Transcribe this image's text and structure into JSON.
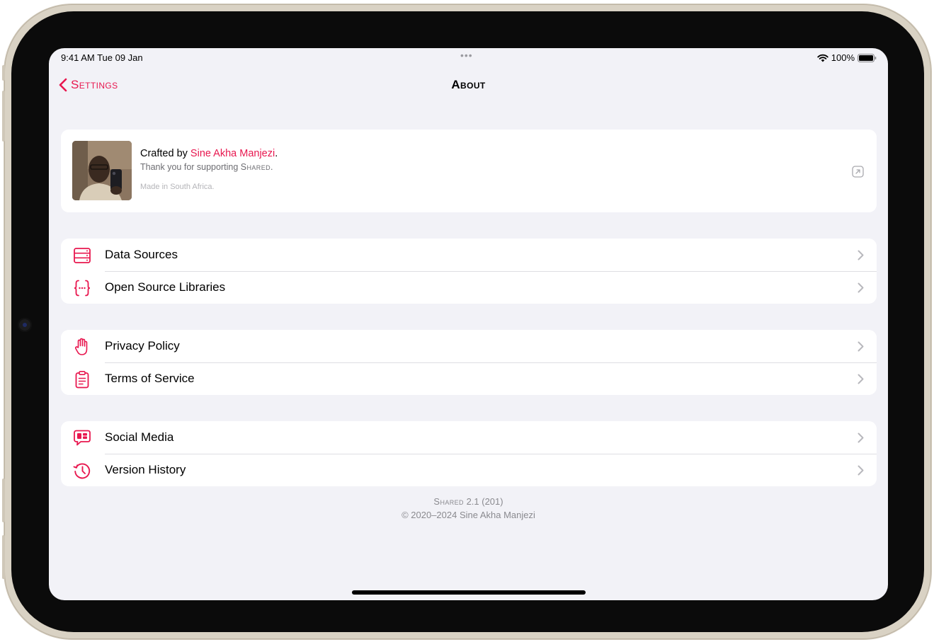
{
  "status_bar": {
    "time": "9:41 AM  Tue 09 Jan",
    "dots": "•••",
    "battery": "100%"
  },
  "nav": {
    "back_label": "Settings",
    "title": "About"
  },
  "profile": {
    "crafted_prefix": "Crafted by ",
    "author": "Sine Akha Manjezi",
    "crafted_suffix": ".",
    "thanks_prefix": "Thank you for supporting ",
    "app_name": "Shared",
    "thanks_suffix": ".",
    "origin": "Made in South Africa."
  },
  "groups": [
    {
      "rows": [
        {
          "label": "Data Sources",
          "icon": "server-rack-icon"
        },
        {
          "label": "Open Source Libraries",
          "icon": "curly-braces-icon"
        }
      ]
    },
    {
      "rows": [
        {
          "label": "Privacy Policy",
          "icon": "raised-hand-icon"
        },
        {
          "label": "Terms of Service",
          "icon": "clipboard-icon"
        }
      ]
    },
    {
      "rows": [
        {
          "label": "Social Media",
          "icon": "speech-bubble-icon"
        },
        {
          "label": "Version History",
          "icon": "clock-history-icon"
        }
      ]
    }
  ],
  "footer": {
    "app_name": "Shared",
    "version": " 2.1 (201)",
    "copyright": "© 2020–2024 Sine Akha Manjezi"
  },
  "colors": {
    "accent": "#e8174f",
    "background": "#f2f2f7",
    "card": "#ffffff"
  }
}
